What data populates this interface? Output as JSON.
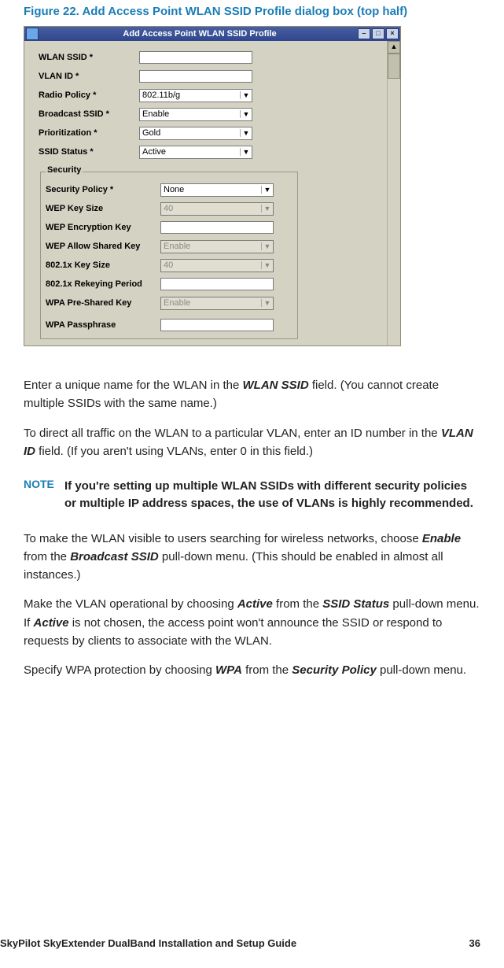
{
  "caption": "Figure 22. Add Access Point WLAN SSID Profile dialog box (top half)",
  "dialog": {
    "title": "Add Access Point WLAN SSID Profile",
    "minbtn": "–",
    "maxbtn": "□",
    "closebtn": "×",
    "scrollUp": "▲",
    "scrollDown": "▼",
    "fields": {
      "wlan_ssid": {
        "label": "WLAN SSID *",
        "value": ""
      },
      "vlan_id": {
        "label": "VLAN ID *",
        "value": ""
      },
      "radio_policy": {
        "label": "Radio Policy *",
        "value": "802.11b/g"
      },
      "broadcast_ssid": {
        "label": "Broadcast SSID *",
        "value": "Enable"
      },
      "prioritization": {
        "label": "Prioritization *",
        "value": "Gold"
      },
      "ssid_status": {
        "label": "SSID Status *",
        "value": "Active"
      }
    },
    "security": {
      "legend": "Security",
      "security_policy": {
        "label": "Security Policy *",
        "value": "None"
      },
      "wep_key_size": {
        "label": "WEP Key Size",
        "value": "40"
      },
      "wep_encryption_key": {
        "label": "WEP Encryption Key",
        "value": ""
      },
      "wep_allow_shared": {
        "label": "WEP Allow Shared Key",
        "value": "Enable"
      },
      "x8021_key_size": {
        "label": "802.1x Key Size",
        "value": "40"
      },
      "x8021_rekey": {
        "label": "802.1x Rekeying Period",
        "value": ""
      },
      "wpa_psk": {
        "label": "WPA Pre-Shared Key",
        "value": "Enable"
      },
      "wpa_pass": {
        "label": "WPA Passphrase",
        "value": ""
      }
    }
  },
  "body": {
    "p1a": "Enter a unique name for the WLAN in the ",
    "p1_i1": "WLAN SSID",
    "p1b": " field. (You cannot create multiple SSIDs with the same name.)",
    "p2a": "To direct all traffic on the WLAN to a particular VLAN, enter an ID number in the ",
    "p2_i1": "VLAN ID",
    "p2b": " field. (If you aren't using VLANs, enter 0 in this field.)",
    "note_label": "NOTE",
    "note_text": "If you're setting up multiple WLAN SSIDs with different security policies or multiple IP address spaces, the use of VLANs is highly recommended.",
    "p3a": "To make the WLAN visible to users searching for wireless networks, choose ",
    "p3_i1": "Enable",
    "p3b": " from the ",
    "p3_i2": "Broadcast SSID",
    "p3c": " pull-down menu. (This should be enabled in almost all instances.)",
    "p4a": "Make the VLAN operational by choosing ",
    "p4_i1": "Active",
    "p4b": " from the ",
    "p4_i2": "SSID Status",
    "p4c": " pull-down menu. If ",
    "p4_i3": "Active",
    "p4d": " is not chosen, the access point won't announce the SSID or respond to requests by clients to associate with the WLAN.",
    "p5a": "Specify WPA protection by choosing ",
    "p5_i1": "WPA",
    "p5b": " from the ",
    "p5_i2": "Security Policy",
    "p5c": " pull-down menu."
  },
  "footer": {
    "left": "SkyPilot SkyExtender DualBand Installation and Setup Guide",
    "right": "36"
  }
}
